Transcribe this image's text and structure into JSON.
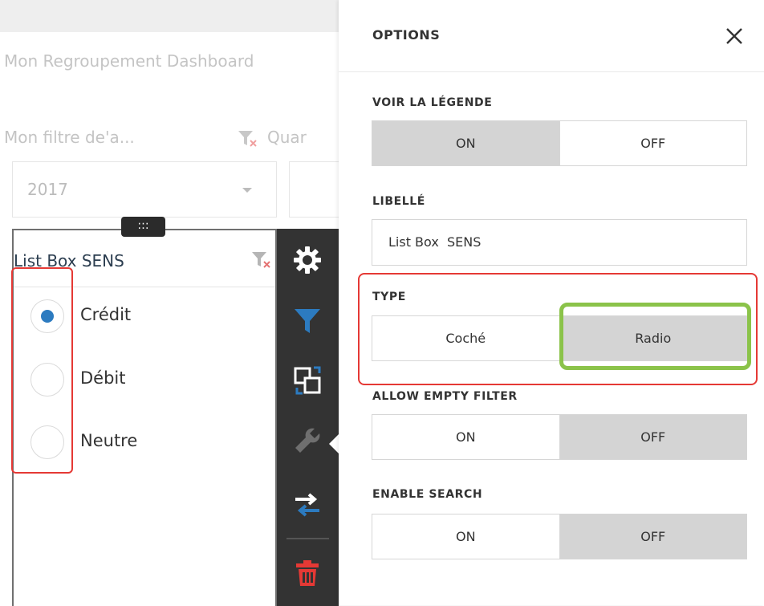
{
  "dashboard": {
    "title": "Mon Regroupement Dashboard",
    "filter_label": "Mon filtre de'a...",
    "second_filter_label": "Quar",
    "year_value": "2017"
  },
  "list_box": {
    "handle_glyph": ":::",
    "title": "List Box SENS",
    "options": [
      {
        "label": "Crédit",
        "checked": true
      },
      {
        "label": "Débit",
        "checked": false
      },
      {
        "label": "Neutre",
        "checked": false
      }
    ]
  },
  "toolbar": {
    "items": [
      "gear-icon",
      "filter-icon",
      "convert-icon",
      "wrench-icon",
      "swap-icon",
      "trash-icon"
    ],
    "colors": {
      "gear": "#ffffff",
      "filter": "#2c7bc0",
      "wrench": "#6f6f6f",
      "trash": "#e53935",
      "background": "#333333"
    }
  },
  "options_panel": {
    "title": "OPTIONS",
    "legend": {
      "label": "VOIR LA LÉGENDE",
      "on": "ON",
      "off": "OFF",
      "selected": "ON"
    },
    "caption": {
      "label": "LIBELLÉ",
      "value": "List Box  SENS"
    },
    "type": {
      "label": "TYPE",
      "checked_option": "Coché",
      "radio_option": "Radio",
      "selected": "Radio"
    },
    "allow_empty": {
      "label": "ALLOW EMPTY FILTER",
      "on": "ON",
      "off": "OFF",
      "selected": "OFF"
    },
    "search": {
      "label": "ENABLE SEARCH",
      "on": "ON",
      "off": "OFF",
      "selected": "OFF"
    }
  },
  "highlights": {
    "red": "#e53935",
    "green": "#8bc34a"
  }
}
